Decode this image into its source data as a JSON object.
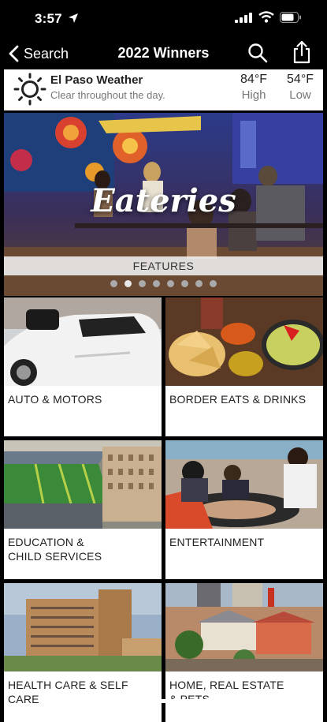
{
  "status_bar": {
    "time": "3:57"
  },
  "nav": {
    "back_label": "Search",
    "title": "2022 Winners"
  },
  "weather": {
    "city": "El Paso Weather",
    "description": "Clear throughout the day.",
    "high_value": "84°F",
    "high_label": "High",
    "low_value": "54°F",
    "low_label": "Low"
  },
  "feature": {
    "title": "Eateries",
    "section_label": "FEATURES",
    "slide_count": 8,
    "active_slide": 1
  },
  "categories": [
    {
      "label_line1": "AUTO & MOTORS",
      "label_line2": ""
    },
    {
      "label_line1": "BORDER EATS & DRINKS",
      "label_line2": ""
    },
    {
      "label_line1": "EDUCATION &",
      "label_line2": "CHILD SERVICES"
    },
    {
      "label_line1": "ENTERTAINMENT",
      "label_line2": ""
    },
    {
      "label_line1": "HEALTH CARE & SELF CARE",
      "label_line2": ""
    },
    {
      "label_line1": "HOME, REAL ESTATE",
      "label_line2": "& PETS"
    }
  ],
  "colors": {
    "background": "#000000",
    "tile": "#ffffff",
    "text_dark": "#222222",
    "text_muted": "#777777"
  }
}
